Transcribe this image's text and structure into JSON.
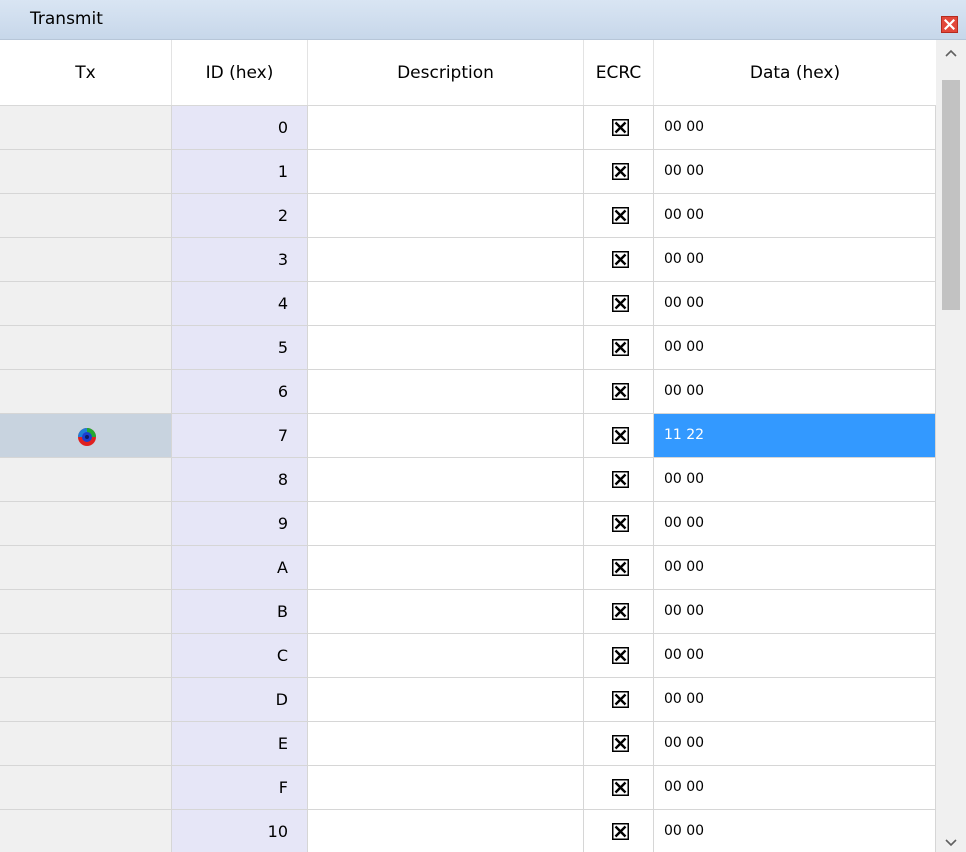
{
  "panel": {
    "title": "Transmit",
    "close_icon": "close-icon"
  },
  "columns": {
    "tx": "Tx",
    "id": "ID (hex)",
    "description": "Description",
    "ecrc": "ECRC",
    "data": "Data (hex)"
  },
  "colors": {
    "selection": "#3399ff",
    "id_column": "#e6e6f7",
    "close_button": "#e2473a"
  },
  "rows": [
    {
      "tx": "",
      "id": "0",
      "description": "",
      "ecrc": true,
      "data": "00 00",
      "active": false
    },
    {
      "tx": "",
      "id": "1",
      "description": "",
      "ecrc": true,
      "data": "00 00",
      "active": false
    },
    {
      "tx": "",
      "id": "2",
      "description": "",
      "ecrc": true,
      "data": "00 00",
      "active": false
    },
    {
      "tx": "",
      "id": "3",
      "description": "",
      "ecrc": true,
      "data": "00 00",
      "active": false
    },
    {
      "tx": "",
      "id": "4",
      "description": "",
      "ecrc": true,
      "data": "00 00",
      "active": false
    },
    {
      "tx": "",
      "id": "5",
      "description": "",
      "ecrc": true,
      "data": "00 00",
      "active": false
    },
    {
      "tx": "",
      "id": "6",
      "description": "",
      "ecrc": true,
      "data": "00 00",
      "active": false
    },
    {
      "tx": "transmit-status-icon",
      "id": "7",
      "description": "",
      "ecrc": true,
      "data": "11 22",
      "active": true
    },
    {
      "tx": "",
      "id": "8",
      "description": "",
      "ecrc": true,
      "data": "00 00",
      "active": false
    },
    {
      "tx": "",
      "id": "9",
      "description": "",
      "ecrc": true,
      "data": "00 00",
      "active": false
    },
    {
      "tx": "",
      "id": "A",
      "description": "",
      "ecrc": true,
      "data": "00 00",
      "active": false
    },
    {
      "tx": "",
      "id": "B",
      "description": "",
      "ecrc": true,
      "data": "00 00",
      "active": false
    },
    {
      "tx": "",
      "id": "C",
      "description": "",
      "ecrc": true,
      "data": "00 00",
      "active": false
    },
    {
      "tx": "",
      "id": "D",
      "description": "",
      "ecrc": true,
      "data": "00 00",
      "active": false
    },
    {
      "tx": "",
      "id": "E",
      "description": "",
      "ecrc": true,
      "data": "00 00",
      "active": false
    },
    {
      "tx": "",
      "id": "F",
      "description": "",
      "ecrc": true,
      "data": "00 00",
      "active": false
    },
    {
      "tx": "",
      "id": "10",
      "description": "",
      "ecrc": true,
      "data": "00 00",
      "active": false
    }
  ]
}
